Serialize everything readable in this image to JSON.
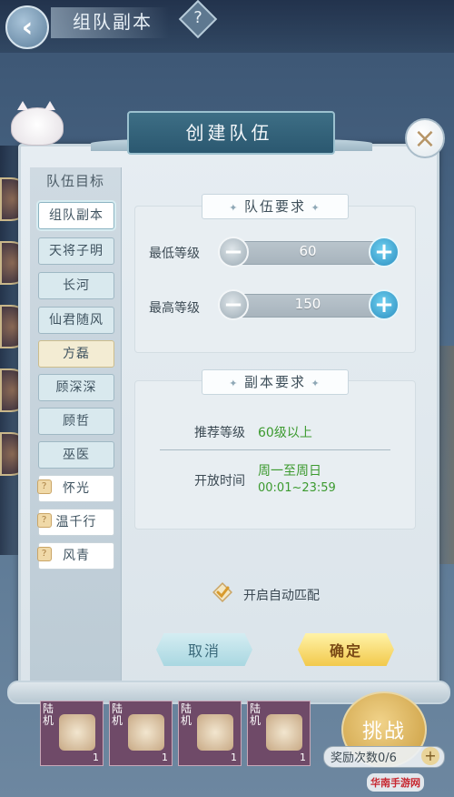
{
  "header": {
    "title": "组队副本",
    "help_glyph": "?"
  },
  "dialog": {
    "title": "创建队伍"
  },
  "sidebar": {
    "title": "队伍目标",
    "items": [
      {
        "label": "组队副本",
        "state": "active"
      },
      {
        "label": "天将子明",
        "state": "normal"
      },
      {
        "label": "长河",
        "state": "normal"
      },
      {
        "label": "仙君随风",
        "state": "normal"
      },
      {
        "label": "方磊",
        "state": "gold"
      },
      {
        "label": "顾深深",
        "state": "normal"
      },
      {
        "label": "顾哲",
        "state": "normal"
      },
      {
        "label": "巫医",
        "state": "normal"
      },
      {
        "label": "怀光",
        "state": "locked"
      },
      {
        "label": "温千行",
        "state": "locked"
      },
      {
        "label": "风青",
        "state": "locked"
      }
    ]
  },
  "team_requirements": {
    "label": "队伍要求",
    "min_level": {
      "label": "最低等级",
      "value": "60"
    },
    "max_level": {
      "label": "最高等级",
      "value": "150"
    }
  },
  "dungeon_requirements": {
    "label": "副本要求",
    "recommended": {
      "label": "推荐等级",
      "value": "60级以上"
    },
    "open_time": {
      "label": "开放时间",
      "days": "周一至周日",
      "hours": "00:01~23:59"
    }
  },
  "auto_match": {
    "label": "开启自动匹配",
    "checked": true
  },
  "buttons": {
    "cancel": "取消",
    "confirm": "确定"
  },
  "bottom": {
    "cards": [
      {
        "tag": "陆机",
        "count": "1"
      },
      {
        "tag": "陆机",
        "count": "1"
      },
      {
        "tag": "陆机",
        "count": "1"
      },
      {
        "tag": "陆机",
        "count": "1"
      }
    ],
    "challenge": "挑战",
    "reward": "奖励次数0/6",
    "reward_plus": "+"
  },
  "watermark": "华南手游网",
  "colors": {
    "accent_green": "#3c9a2f",
    "confirm_gold": "#f2c94c",
    "plus_blue": "#2b8ec0"
  }
}
